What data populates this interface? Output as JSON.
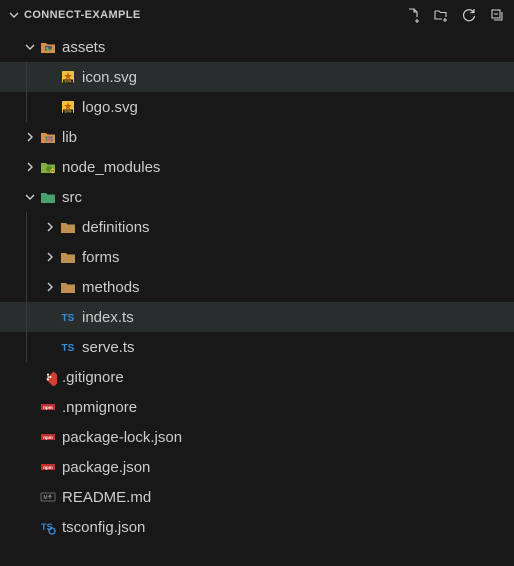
{
  "header": {
    "title": "CONNECT-EXAMPLE"
  },
  "tree": [
    {
      "depth": 0,
      "kind": "folder",
      "expanded": true,
      "icon": "assets-folder",
      "label": "assets"
    },
    {
      "depth": 1,
      "kind": "file",
      "icon": "svg-file",
      "label": "icon.svg",
      "selected": true
    },
    {
      "depth": 1,
      "kind": "file",
      "icon": "svg-file",
      "label": "logo.svg"
    },
    {
      "depth": 0,
      "kind": "folder",
      "expanded": false,
      "icon": "lib-folder",
      "label": "lib"
    },
    {
      "depth": 0,
      "kind": "folder",
      "expanded": false,
      "icon": "node-folder",
      "label": "node_modules"
    },
    {
      "depth": 0,
      "kind": "folder",
      "expanded": true,
      "icon": "src-folder",
      "label": "src"
    },
    {
      "depth": 1,
      "kind": "folder",
      "expanded": false,
      "icon": "generic-folder",
      "label": "definitions"
    },
    {
      "depth": 1,
      "kind": "folder",
      "expanded": false,
      "icon": "generic-folder",
      "label": "forms"
    },
    {
      "depth": 1,
      "kind": "folder",
      "expanded": false,
      "icon": "generic-folder",
      "label": "methods"
    },
    {
      "depth": 1,
      "kind": "file",
      "icon": "ts-file",
      "label": "index.ts",
      "selected": true
    },
    {
      "depth": 1,
      "kind": "file",
      "icon": "ts-file",
      "label": "serve.ts"
    },
    {
      "depth": 0,
      "kind": "file",
      "icon": "git-file",
      "label": ".gitignore"
    },
    {
      "depth": 0,
      "kind": "file",
      "icon": "npm-file",
      "label": ".npmignore"
    },
    {
      "depth": 0,
      "kind": "file",
      "icon": "npm-file",
      "label": "package-lock.json"
    },
    {
      "depth": 0,
      "kind": "file",
      "icon": "npm-file",
      "label": "package.json"
    },
    {
      "depth": 0,
      "kind": "file",
      "icon": "md-file",
      "label": "README.md"
    },
    {
      "depth": 0,
      "kind": "file",
      "icon": "tsconf-file",
      "label": "tsconfig.json"
    }
  ]
}
